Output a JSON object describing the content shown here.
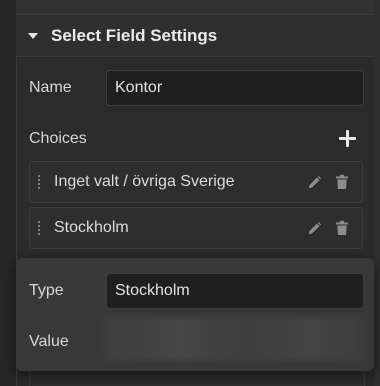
{
  "section": {
    "title": "Select Field Settings"
  },
  "name_field": {
    "label": "Name",
    "value": "Kontor"
  },
  "choices": {
    "label": "Choices",
    "items": [
      {
        "label": "Inget valt / övriga Sverige"
      },
      {
        "label": "Stockholm"
      }
    ]
  },
  "popover": {
    "type_label": "Type",
    "type_value": "Stockholm",
    "value_label": "Value"
  },
  "icons": {
    "add": "plus-icon",
    "section_toggle": "caret-down-icon",
    "drag": "drag-handle-icon",
    "edit": "pencil-icon",
    "delete": "trash-icon"
  }
}
